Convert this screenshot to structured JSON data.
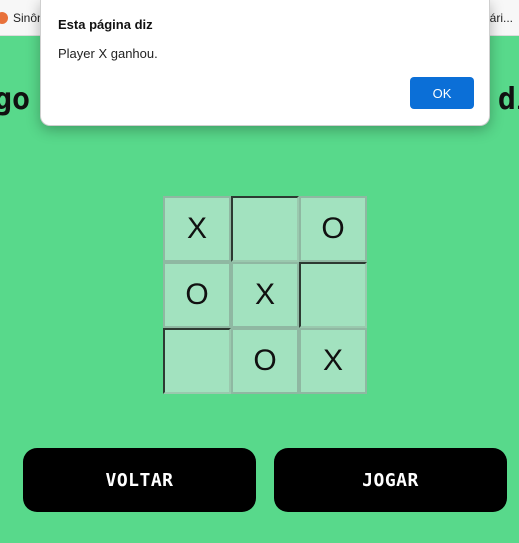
{
  "browser": {
    "bookmarks": [
      {
        "label": "Sinôn",
        "icon": "bookmark-favicon"
      },
      {
        "label": "nári...",
        "icon": "bookmark-favicon"
      }
    ]
  },
  "page": {
    "title_left": "go",
    "title_right": "di"
  },
  "board": {
    "cells": [
      "X",
      "",
      "O",
      "O",
      "X",
      "",
      "",
      "O",
      "X"
    ]
  },
  "buttons": {
    "back": "VOLTAR",
    "play": "JOGAR"
  },
  "dialog": {
    "title": "Esta página diz",
    "message": "Player X ganhou.",
    "ok": "OK"
  },
  "colors": {
    "background": "#58d98b",
    "cell": "#a2e2bf",
    "button": "#000000",
    "ok_button": "#0b6fd7"
  }
}
